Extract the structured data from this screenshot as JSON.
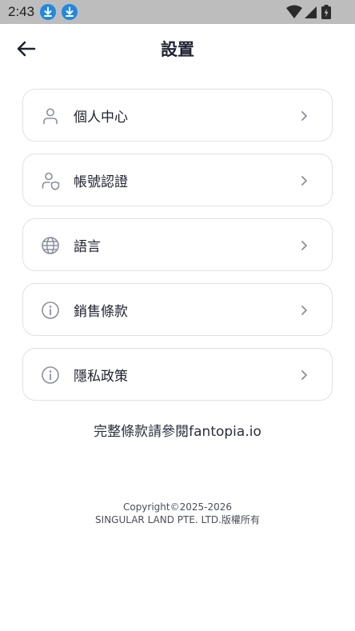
{
  "status_bar": {
    "time": "2:43",
    "icons": [
      "download-icon",
      "download-icon",
      "wifi-icon",
      "signal-icon",
      "battery-icon"
    ]
  },
  "header": {
    "title": "設置",
    "back_icon": "arrow-left-icon"
  },
  "menu": {
    "items": [
      {
        "label": "個人中心",
        "icon": "person-icon"
      },
      {
        "label": "帳號認證",
        "icon": "person-shield-icon"
      },
      {
        "label": "語言",
        "icon": "globe-icon"
      },
      {
        "label": "銷售條款",
        "icon": "info-icon"
      },
      {
        "label": "隱私政策",
        "icon": "info-icon"
      }
    ]
  },
  "footer": {
    "terms_note": "完整條款請參閱fantopia.io",
    "copyright_line1": "Copyright©2025-2026",
    "copyright_line2": "SINGULAR LAND PTE. LTD.版權所有"
  },
  "colors": {
    "status_bar_bg": "#bdbdbd",
    "download_badge": "#1e88e5",
    "card_border": "#dfe1e6",
    "text_primary": "#1f2230",
    "icon_gray": "#8a8f9c"
  }
}
